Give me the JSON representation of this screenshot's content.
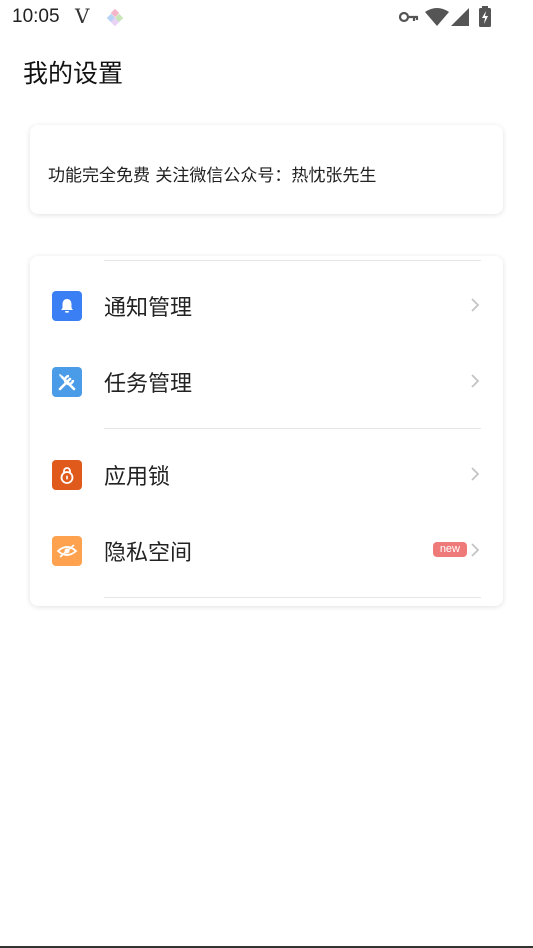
{
  "status_bar": {
    "time": "10:05",
    "carrier_glyph": "V",
    "icons": [
      "app-diamond-icon",
      "vpn-key-icon",
      "wifi-icon",
      "signal-icon",
      "battery-icon"
    ]
  },
  "page": {
    "title": "我的设置"
  },
  "notice": {
    "text": "功能完全免费 关注微信公众号：热忱张先生"
  },
  "menu": {
    "items": [
      {
        "label": "通知管理",
        "icon": "bell-icon",
        "color": "#3b7ff5"
      },
      {
        "label": "任务管理",
        "icon": "tools-icon",
        "color": "#4a9be8"
      },
      {
        "label": "应用锁",
        "icon": "lock-icon",
        "color": "#e05a1c"
      },
      {
        "label": "隐私空间",
        "icon": "eye-hidden-icon",
        "color": "#ffa24f",
        "badge": "new"
      }
    ]
  },
  "colors": {
    "badge": "#ef7a7a",
    "chevron": "#c4c4c4",
    "divider": "#e6e6e6"
  }
}
